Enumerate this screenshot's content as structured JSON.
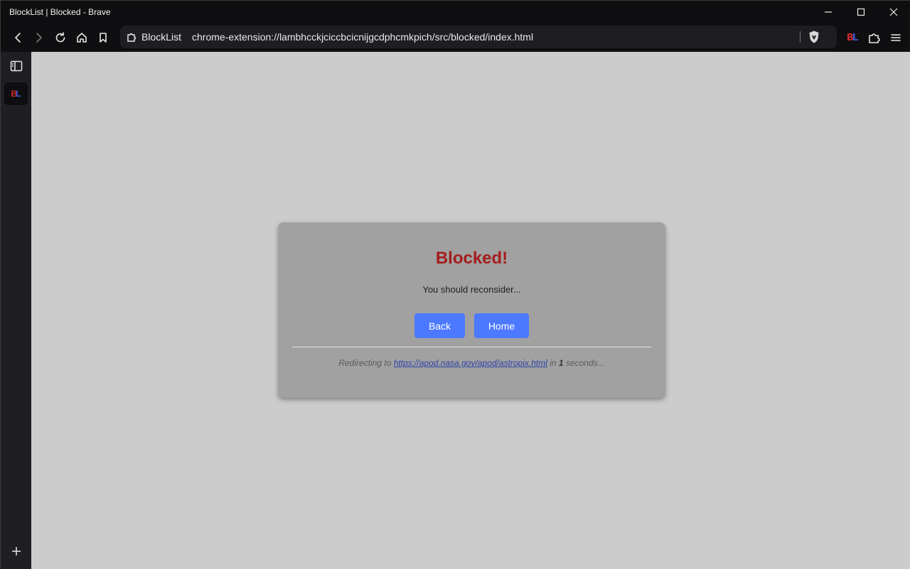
{
  "window": {
    "title": "BlockList | Blocked - Brave"
  },
  "toolbar": {
    "site_label": "BlockList",
    "url": "chrome-extension://lambhcckjciccbcicnijgcdphcmkpich/src/blocked/index.html",
    "extension_letters": [
      "B",
      "L"
    ]
  },
  "sidebar": {
    "extension_letters": [
      "B",
      "L"
    ]
  },
  "page": {
    "heading": "Blocked!",
    "message": "You should reconsider...",
    "back_label": "Back",
    "home_label": "Home",
    "redirect_prefix": "Redirecting to",
    "redirect_url": "https://apod.nasa.gov/apod/astropix.html",
    "redirect_in": "in",
    "redirect_count": "1",
    "redirect_suffix": "seconds..."
  },
  "colors": {
    "heading": "#a51c1c",
    "button": "#4c79ff",
    "card": "#a1a1a1",
    "page_bg": "#cccccc"
  },
  "icons": [
    "back-icon",
    "forward-icon",
    "reload-icon",
    "home-icon",
    "bookmark-icon",
    "extension-puzzle-icon",
    "brave-shield-icon",
    "menu-icon",
    "sidebar-toggle-icon",
    "add-icon",
    "minimize-icon",
    "maximize-icon",
    "close-icon"
  ]
}
